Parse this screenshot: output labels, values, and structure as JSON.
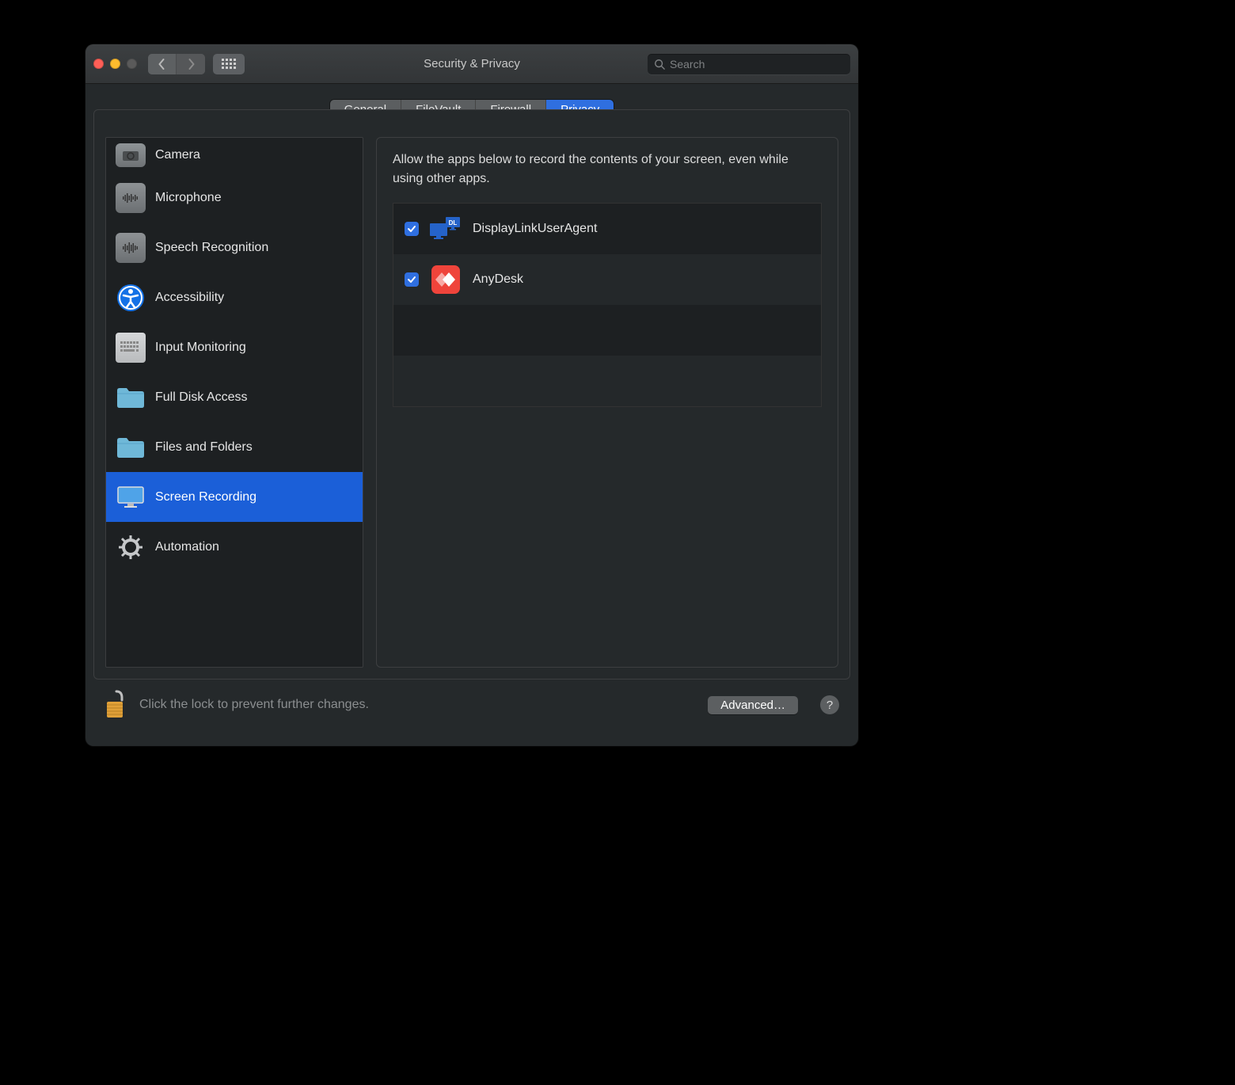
{
  "window": {
    "title": "Security & Privacy"
  },
  "toolbar": {
    "search_placeholder": "Search"
  },
  "tabs": [
    {
      "label": "General",
      "active": false
    },
    {
      "label": "FileVault",
      "active": false
    },
    {
      "label": "Firewall",
      "active": false
    },
    {
      "label": "Privacy",
      "active": true
    }
  ],
  "sidebar": {
    "items": [
      {
        "label": "Camera",
        "icon": "camera",
        "selected": false
      },
      {
        "label": "Microphone",
        "icon": "microphone",
        "selected": false
      },
      {
        "label": "Speech Recognition",
        "icon": "speech",
        "selected": false
      },
      {
        "label": "Accessibility",
        "icon": "accessibility",
        "selected": false
      },
      {
        "label": "Input Monitoring",
        "icon": "keyboard",
        "selected": false
      },
      {
        "label": "Full Disk Access",
        "icon": "folder",
        "selected": false
      },
      {
        "label": "Files and Folders",
        "icon": "folder",
        "selected": false
      },
      {
        "label": "Screen Recording",
        "icon": "display",
        "selected": true
      },
      {
        "label": "Automation",
        "icon": "gear",
        "selected": false
      }
    ]
  },
  "content": {
    "description": "Allow the apps below to record the contents of your screen, even while using other apps.",
    "apps": [
      {
        "name": "DisplayLinkUserAgent",
        "checked": true,
        "icon": "displaylink"
      },
      {
        "name": "AnyDesk",
        "checked": true,
        "icon": "anydesk"
      }
    ]
  },
  "footer": {
    "lock_text": "Click the lock to prevent further changes.",
    "advanced_label": "Advanced…",
    "help_label": "?"
  }
}
